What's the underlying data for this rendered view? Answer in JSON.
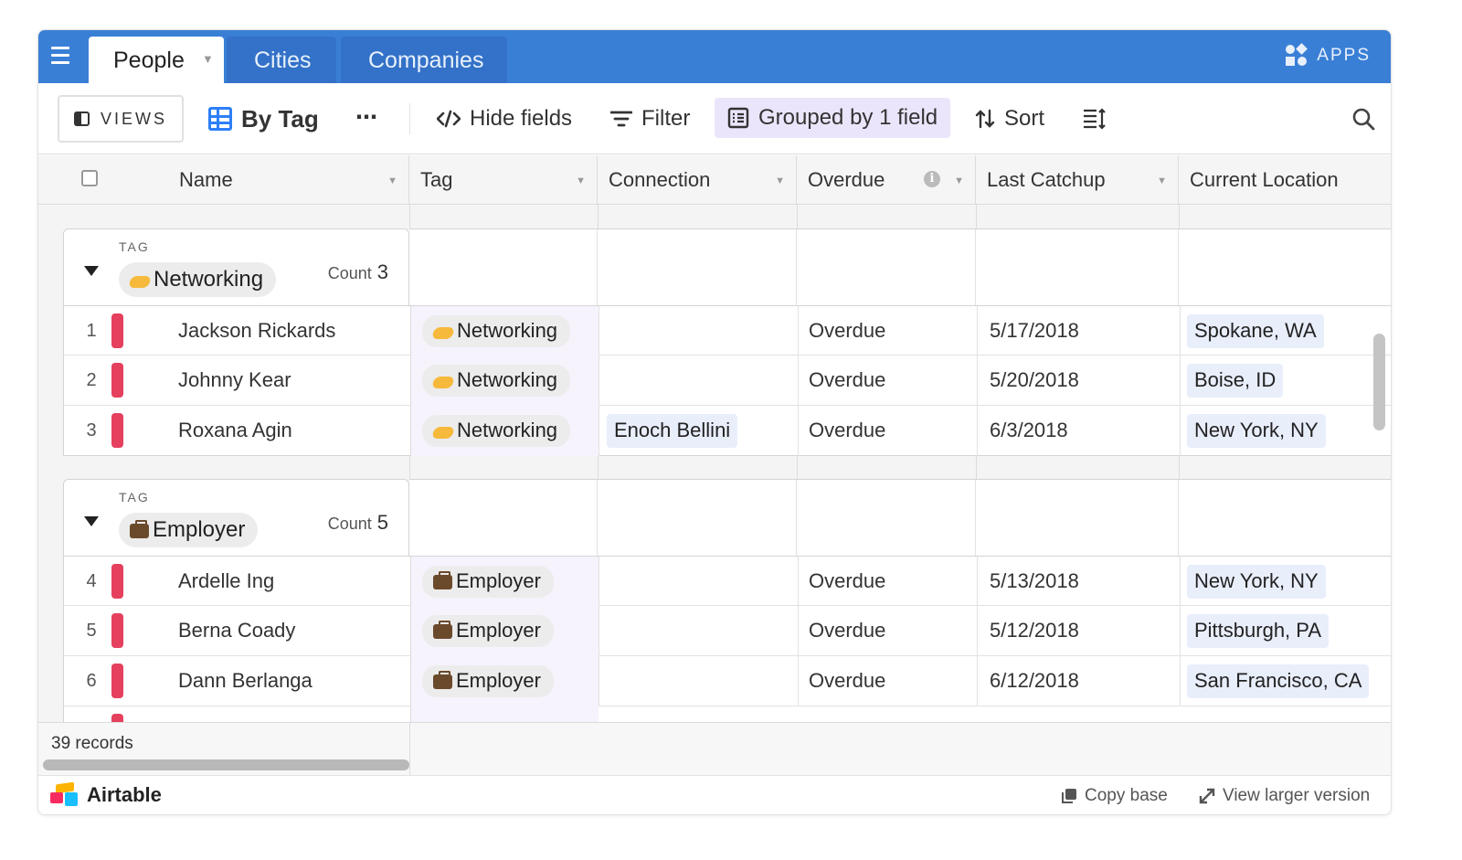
{
  "tabs": [
    {
      "label": "People",
      "active": true
    },
    {
      "label": "Cities",
      "active": false
    },
    {
      "label": "Companies",
      "active": false
    }
  ],
  "apps_label": "APPS",
  "toolbar": {
    "views_label": "VIEWS",
    "view_name": "By Tag",
    "more_label": "⋯",
    "hide_fields": "Hide fields",
    "filter": "Filter",
    "grouped": "Grouped by 1 field",
    "sort": "Sort"
  },
  "columns": [
    "Name",
    "Tag",
    "Connection",
    "Overdue",
    "Last Catchup",
    "Current Location"
  ],
  "groups": [
    {
      "group_label": "TAG",
      "name": "Networking",
      "icon": "handshake-icon",
      "count_label": "Count",
      "count": "3",
      "rows": [
        {
          "num": "1",
          "name": "Jackson Rickards",
          "tag": "Networking",
          "connection": "",
          "overdue": "Overdue",
          "last_catchup": "5/17/2018",
          "location": "Spokane, WA"
        },
        {
          "num": "2",
          "name": "Johnny Kear",
          "tag": "Networking",
          "connection": "",
          "overdue": "Overdue",
          "last_catchup": "5/20/2018",
          "location": "Boise, ID"
        },
        {
          "num": "3",
          "name": "Roxana Agin",
          "tag": "Networking",
          "connection": "Enoch Bellini",
          "overdue": "Overdue",
          "last_catchup": "6/3/2018",
          "location": "New York, NY"
        }
      ]
    },
    {
      "group_label": "TAG",
      "name": "Employer",
      "icon": "briefcase-icon",
      "count_label": "Count",
      "count": "5",
      "rows": [
        {
          "num": "4",
          "name": "Ardelle Ing",
          "tag": "Employer",
          "connection": "",
          "overdue": "Overdue",
          "last_catchup": "5/13/2018",
          "location": "New York, NY"
        },
        {
          "num": "5",
          "name": "Berna Coady",
          "tag": "Employer",
          "connection": "",
          "overdue": "Overdue",
          "last_catchup": "5/12/2018",
          "location": "Pittsburgh, PA"
        },
        {
          "num": "6",
          "name": "Dann Berlanga",
          "tag": "Employer",
          "connection": "",
          "overdue": "Overdue",
          "last_catchup": "6/12/2018",
          "location": "San Francisco, CA"
        }
      ]
    }
  ],
  "records_label": "39 records",
  "footer": {
    "brand": "Airtable",
    "copy_base": "Copy base",
    "view_larger": "View larger version"
  },
  "colors": {
    "tabbar": "#3a7fd6",
    "accent": "#2d7ff9",
    "row_flag": "#e5405e",
    "grouped_bg": "#ebe5fb"
  }
}
